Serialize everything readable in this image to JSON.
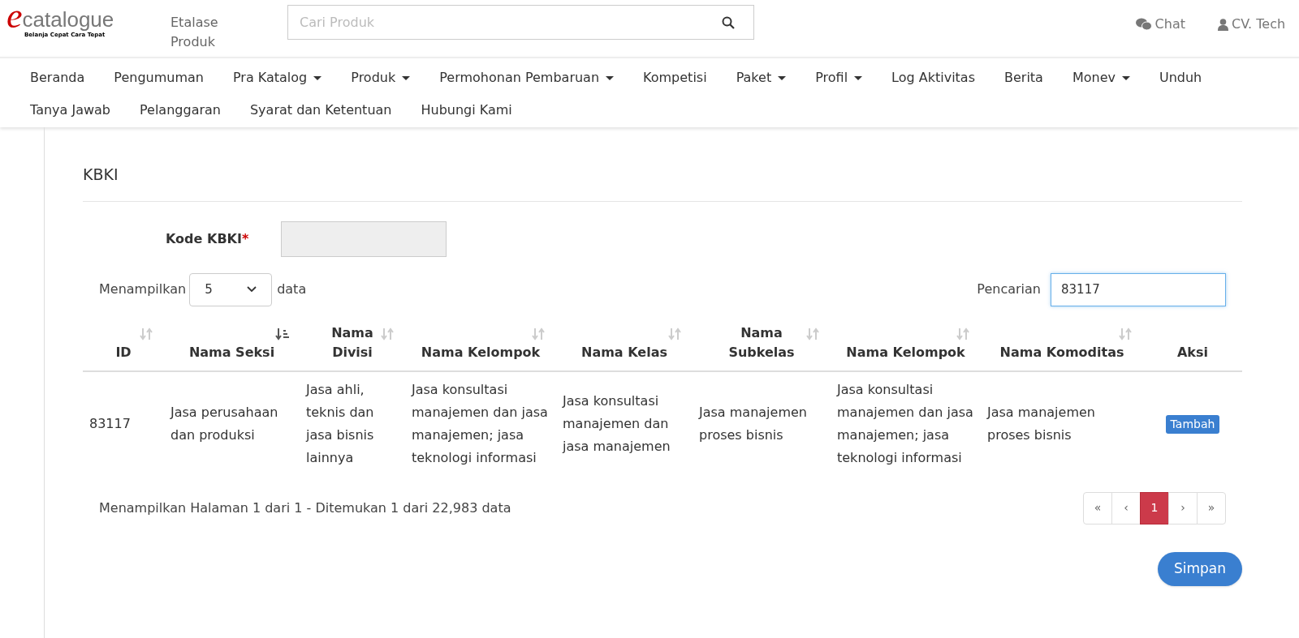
{
  "header": {
    "logo": {
      "letter": "e",
      "word": "catalogue",
      "tagline": "Belanja Cepat Cara Tepat"
    },
    "etalase": "Etalase Produk",
    "search": {
      "placeholder": "Cari Produk"
    },
    "chat": "Chat",
    "user": "CV. Tech"
  },
  "nav": [
    {
      "label": "Beranda",
      "dropdown": false
    },
    {
      "label": "Pengumuman",
      "dropdown": false
    },
    {
      "label": "Pra Katalog",
      "dropdown": true
    },
    {
      "label": "Produk",
      "dropdown": true
    },
    {
      "label": "Permohonan Pembaruan",
      "dropdown": true
    },
    {
      "label": "Kompetisi",
      "dropdown": false
    },
    {
      "label": "Paket",
      "dropdown": true
    },
    {
      "label": "Profil",
      "dropdown": true
    },
    {
      "label": "Log Aktivitas",
      "dropdown": false
    },
    {
      "label": "Berita",
      "dropdown": false
    },
    {
      "label": "Monev",
      "dropdown": true
    },
    {
      "label": "Unduh",
      "dropdown": false
    },
    {
      "label": "Tanya Jawab",
      "dropdown": false
    },
    {
      "label": "Pelanggaran",
      "dropdown": false
    },
    {
      "label": "Syarat dan Ketentuan",
      "dropdown": false
    },
    {
      "label": "Hubungi Kami",
      "dropdown": false
    }
  ],
  "panel": {
    "title": "KBKI",
    "kode_label": "Kode KBKI",
    "required_mark": "*",
    "length_label": "Menampilkan",
    "length_value": "5",
    "length_suffix": "data",
    "search_label": "Pencarian",
    "search_value": "83117"
  },
  "table": {
    "columns": [
      {
        "label": "ID",
        "sortable": true,
        "sorted": false
      },
      {
        "label": "Nama Seksi",
        "sortable": true,
        "sorted": true
      },
      {
        "label": "Nama Divisi",
        "sortable": true,
        "sorted": false
      },
      {
        "label": "Nama Kelompok",
        "sortable": true,
        "sorted": false
      },
      {
        "label": "Nama Kelas",
        "sortable": true,
        "sorted": false
      },
      {
        "label": "Nama Subkelas",
        "sortable": true,
        "sorted": false
      },
      {
        "label": "Nama Kelompok",
        "sortable": true,
        "sorted": false
      },
      {
        "label": "Nama Komoditas",
        "sortable": true,
        "sorted": false
      },
      {
        "label": "Aksi",
        "sortable": false
      }
    ],
    "rows": [
      {
        "cells": [
          "83117",
          "Jasa perusahaan dan produksi",
          "Jasa ahli, teknis dan jasa bisnis lainnya",
          "Jasa konsultasi manajemen dan jasa manajemen; jasa teknologi informasi",
          "Jasa konsultasi manajemen dan jasa manajemen",
          "Jasa manajemen proses bisnis",
          "Jasa konsultasi manajemen dan jasa manajemen; jasa teknologi informasi",
          "Jasa manajemen proses bisnis"
        ],
        "action": "Tambah"
      }
    ]
  },
  "footer": {
    "info": "Menampilkan Halaman 1 dari 1 - Ditemukan 1 dari 22,983 data",
    "pages": [
      {
        "label": "«",
        "selected": false
      },
      {
        "label": "‹",
        "selected": false
      },
      {
        "label": "1",
        "selected": true
      },
      {
        "label": "›",
        "selected": false
      },
      {
        "label": "»",
        "selected": false
      }
    ],
    "save": "Simpan"
  }
}
